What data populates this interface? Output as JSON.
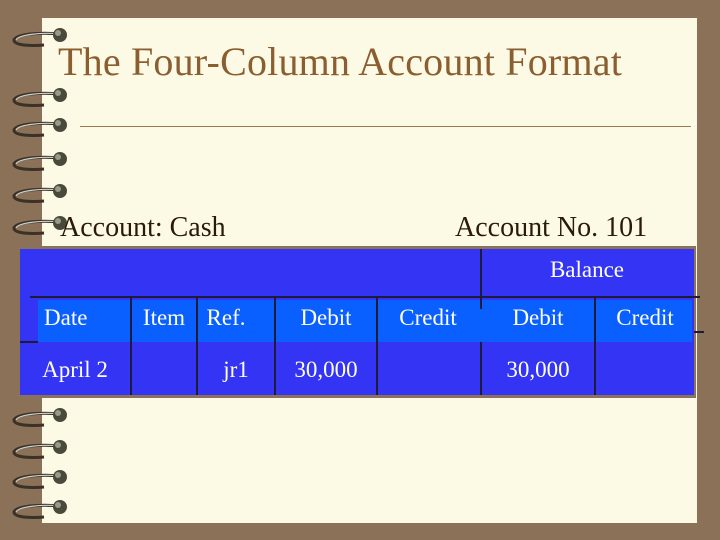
{
  "slide": {
    "title": "The Four-Column Account Format",
    "account_label": "Account: Cash",
    "account_number": "Account No. 101"
  },
  "ledger": {
    "group_header": "Balance",
    "columns": [
      "Date",
      "Item",
      "Ref.",
      "Debit",
      "Credit",
      "Debit",
      "Credit"
    ],
    "rows": [
      {
        "date": "April 2",
        "item": "",
        "ref": "jr1",
        "debit": "30,000",
        "credit": "",
        "balance_debit": "30,000",
        "balance_credit": ""
      }
    ]
  },
  "colors": {
    "background": "#8b7158",
    "paper": "#fcfae4",
    "title": "#8a5e30",
    "table_fill": "#3434f4",
    "header_band": "#0a60ff"
  }
}
